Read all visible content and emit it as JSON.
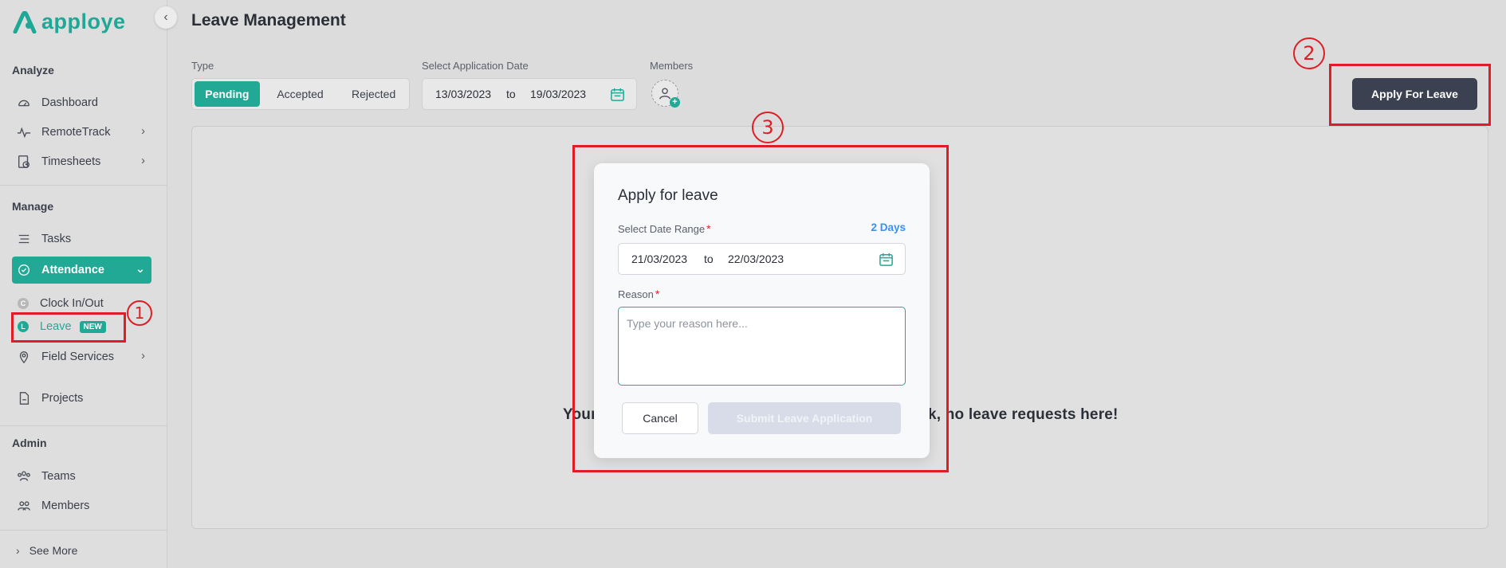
{
  "brand": {
    "name": "apploye"
  },
  "sidebar": {
    "sections": {
      "analyze": "Analyze",
      "manage": "Manage",
      "admin": "Admin"
    },
    "items": {
      "dashboard": "Dashboard",
      "remotetrack": "RemoteTrack",
      "timesheets": "Timesheets",
      "tasks": "Tasks",
      "attendance": "Attendance",
      "clock": "Clock In/Out",
      "leave": "Leave",
      "leave_badge": "NEW",
      "field_services": "Field Services",
      "projects": "Projects",
      "teams": "Teams",
      "members": "Members",
      "see_more": "See More"
    }
  },
  "header": {
    "title": "Leave Management"
  },
  "filters": {
    "type_label": "Type",
    "types": [
      "Pending",
      "Accepted",
      "Rejected"
    ],
    "date_label": "Select Application Date",
    "date_from": "13/03/2023",
    "date_sep": "to",
    "date_to": "19/03/2023",
    "members_label": "Members"
  },
  "apply_button": "Apply For Leave",
  "empty_message": "Your",
  "empty_message_tail": "k, no leave requests here!",
  "modal": {
    "title": "Apply for leave",
    "date_label": "Select Date Range",
    "required_mark": "*",
    "days": "2 Days",
    "date_from": "21/03/2023",
    "date_sep": "to",
    "date_to": "22/03/2023",
    "reason_label": "Reason",
    "reason_placeholder": "Type your reason here...",
    "cancel": "Cancel",
    "submit": "Submit Leave Application"
  },
  "annotations": [
    "1",
    "2",
    "3"
  ],
  "colors": {
    "accent": "#22a996",
    "annotation": "#e01d26",
    "dark_button": "#3b4150",
    "link": "#3b8ff2"
  }
}
